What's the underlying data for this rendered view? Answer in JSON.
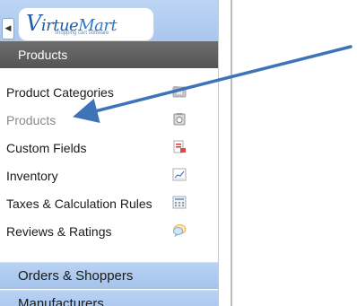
{
  "brand": {
    "logo_text": "VirtueMart",
    "logo_tagline": "shopping cart software"
  },
  "section": {
    "title": "Products"
  },
  "menu": {
    "items": [
      {
        "label": "Product Categories",
        "icon": "folder-icon"
      },
      {
        "label": "Products",
        "icon": "product-box-icon",
        "active": true
      },
      {
        "label": "Custom Fields",
        "icon": "custom-fields-icon"
      },
      {
        "label": "Inventory",
        "icon": "inventory-chart-icon"
      },
      {
        "label": "Taxes & Calculation Rules",
        "icon": "calculator-icon"
      },
      {
        "label": "Reviews & Ratings",
        "icon": "speech-bubble-icon"
      }
    ]
  },
  "nav": {
    "orders": "Orders & Shoppers",
    "manufacturers": "Manufacturers"
  },
  "colors": {
    "header_bg": "#5f5f5f",
    "nav_bg": "#aecaef",
    "arrow": "#3f73b8"
  }
}
